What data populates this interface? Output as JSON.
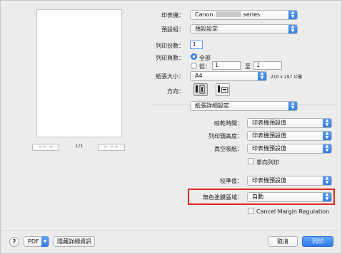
{
  "preview": {
    "prev_label": "<<  <",
    "next_label": ">  >>",
    "page_indicator": "1/1"
  },
  "printer": {
    "label": "印表機：",
    "value_prefix": "Canon",
    "value_suffix": "series"
  },
  "presets": {
    "label": "預設組：",
    "value": "預設設定"
  },
  "copies": {
    "label": "列印份數：",
    "value": "1"
  },
  "pages": {
    "label": "列印頁數：",
    "all_label": "全部",
    "from_label": "從：",
    "from_value": "1",
    "to_label": "至",
    "to_value": "1"
  },
  "paper_size": {
    "label": "紙張大小：",
    "value": "A4",
    "dimensions": "210 x 297 公釐"
  },
  "orientation": {
    "label": "方向："
  },
  "panel_menu": {
    "value": "紙張詳細設定"
  },
  "dry_time": {
    "label": "晾乾時間：",
    "value": "印表機預設值"
  },
  "print_height": {
    "label": "列印頭高度：",
    "value": "印表機預設值"
  },
  "vacuum": {
    "label": "真空吸紙：",
    "value": "印表機預設值"
  },
  "one_way": {
    "label": "單向列印"
  },
  "calibration": {
    "label": "校準值：",
    "value": "印表機預設值"
  },
  "no_spaces": {
    "label": "無色塗膜區域：",
    "value": "自動"
  },
  "cancel_margin": {
    "label": "Cancel Margin Regulation"
  },
  "footer": {
    "help": "?",
    "pdf_label": "PDF",
    "hide_details": "隱藏詳細資訊",
    "cancel": "取消",
    "print": "列印"
  },
  "colors": {
    "accent": "#3b86ee",
    "highlight": "#e0291d"
  }
}
